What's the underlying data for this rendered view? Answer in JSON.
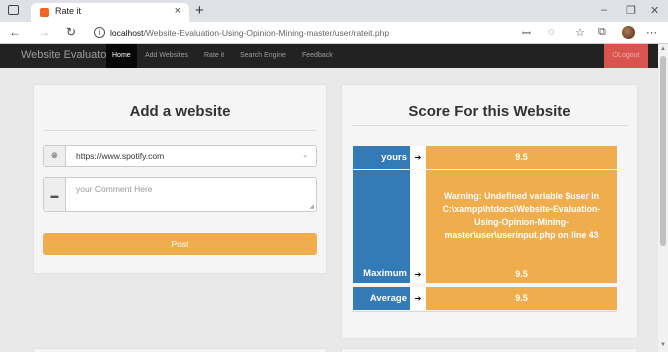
{
  "browser": {
    "tab_title": "Rate it",
    "tab_close": "×",
    "new_tab": "+",
    "url_host": "localhost",
    "url_path": "/Website-Evaluation-Using-Opinion-Mining-master/user/rateit.php",
    "window_controls": [
      "–",
      "❐",
      "✕"
    ]
  },
  "navbar": {
    "brand": "Website Evaluator",
    "items": [
      {
        "label": "Home",
        "active": true
      },
      {
        "label": "Add Websites",
        "active": false
      },
      {
        "label": "Rate it",
        "active": false
      },
      {
        "label": "Search Engine",
        "active": false
      },
      {
        "label": "Feedback",
        "active": false
      }
    ],
    "logout": "⏻Logout"
  },
  "add_panel": {
    "title": "Add a website",
    "website_select_value": "https://www.spotify.com",
    "comment_placeholder": "your Comment Here",
    "post_button": "Post"
  },
  "score_panel": {
    "title": "Score For this Website",
    "rows": {
      "yours": {
        "label": "yours",
        "value": "9.5"
      },
      "maximum": {
        "label": "Maximum",
        "warning": "Warning: Undefined variable $user in C:\\xampp\\htdocs\\Website-Evaluation-Using-Opinion-Mining-master\\user\\userinput.php on line 43",
        "value": "9.5"
      },
      "average": {
        "label": "Average",
        "value": "9.5"
      }
    },
    "arrow": "➔"
  },
  "colors": {
    "label_blue": "#337ab7",
    "value_orange": "#f0ad4e",
    "navbar": "#222222",
    "logout_red": "#d9534f"
  }
}
